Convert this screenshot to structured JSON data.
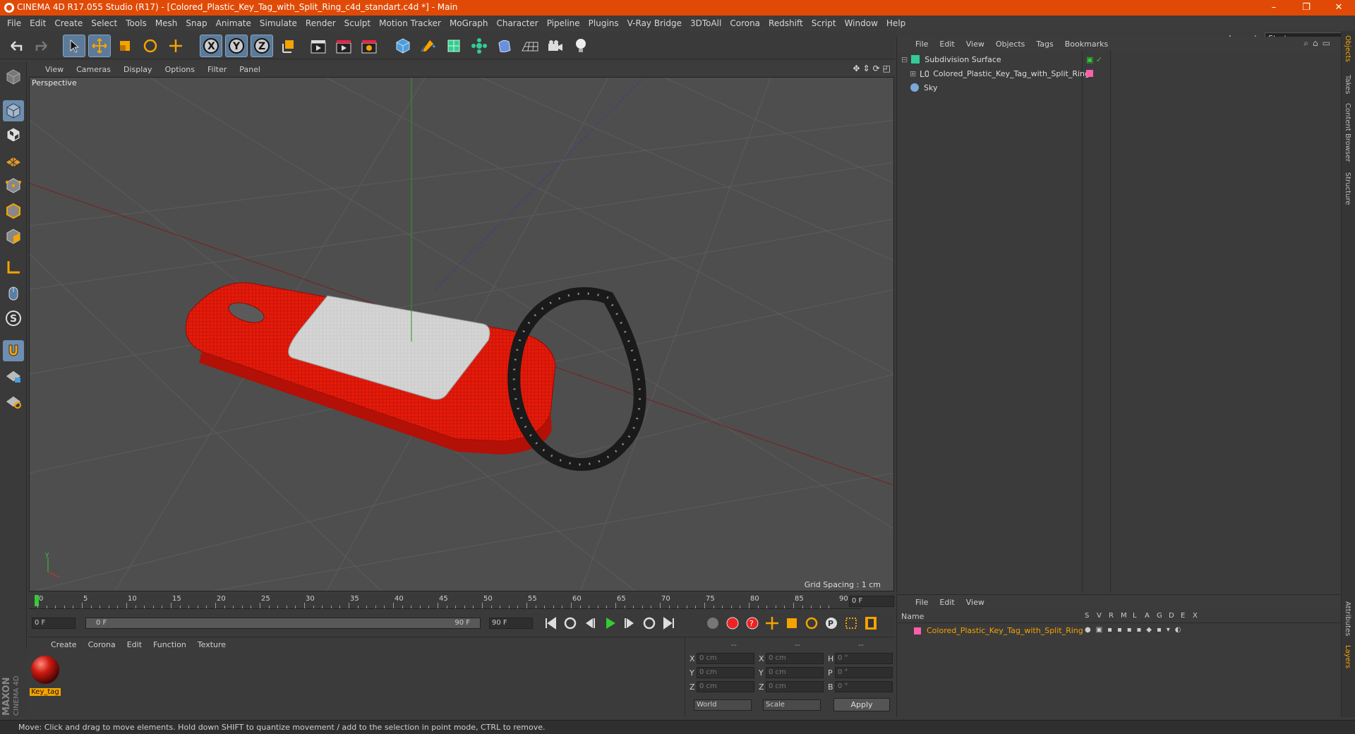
{
  "window": {
    "title": "CINEMA 4D R17.055 Studio (R17) - [Colored_Plastic_Key_Tag_with_Split_Ring_c4d_standart.c4d *] - Main",
    "minimize": "–",
    "maximize": "❐",
    "close": "✕"
  },
  "menu": [
    "File",
    "Edit",
    "Create",
    "Select",
    "Tools",
    "Mesh",
    "Snap",
    "Animate",
    "Simulate",
    "Render",
    "Sculpt",
    "Motion Tracker",
    "MoGraph",
    "Character",
    "Pipeline",
    "Plugins",
    "V-Ray Bridge",
    "3DToAll",
    "Corona",
    "Redshift",
    "Script",
    "Window",
    "Help"
  ],
  "layout": {
    "label": "Layout:",
    "value": "Startup"
  },
  "viewport": {
    "menu": [
      "View",
      "Cameras",
      "Display",
      "Options",
      "Filter",
      "Panel"
    ],
    "label": "Perspective",
    "grid_spacing": "Grid Spacing : 1 cm"
  },
  "timeline": {
    "ticks": [
      "0",
      "5",
      "10",
      "15",
      "20",
      "25",
      "30",
      "35",
      "40",
      "45",
      "50",
      "55",
      "60",
      "65",
      "70",
      "75",
      "80",
      "85",
      "90"
    ],
    "current_frame": "0 F",
    "start": "0 F",
    "range_start": "0 F",
    "range_end": "90 F",
    "end": "90 F"
  },
  "material_manager": {
    "menu": [
      "Create",
      "Corona",
      "Edit",
      "Function",
      "Texture"
    ],
    "materials": [
      {
        "name": "Key_tag",
        "color": "#cc1a10"
      }
    ]
  },
  "coordinates": {
    "headers": [
      "--",
      "--",
      "--"
    ],
    "rows": [
      {
        "a": "X",
        "av": "0 cm",
        "b": "X",
        "bv": "0 cm",
        "c": "H",
        "cv": "0 °"
      },
      {
        "a": "Y",
        "av": "0 cm",
        "b": "Y",
        "bv": "0 cm",
        "c": "P",
        "cv": "0 °"
      },
      {
        "a": "Z",
        "av": "0 cm",
        "b": "Z",
        "bv": "0 cm",
        "c": "B",
        "cv": "0 °"
      }
    ],
    "mode1": "World",
    "mode2": "Scale",
    "apply": "Apply"
  },
  "object_manager": {
    "menu": [
      "File",
      "Edit",
      "View",
      "Objects",
      "Tags",
      "Bookmarks"
    ],
    "objects": [
      {
        "name": "Subdivision Surface",
        "icon": "subdivision-icon"
      },
      {
        "name": "Colored_Plastic_Key_Tag_with_Split_Ring",
        "icon": "null-icon"
      },
      {
        "name": "Sky",
        "icon": "sky-icon"
      }
    ]
  },
  "layer_manager": {
    "menu": [
      "File",
      "Edit",
      "View"
    ],
    "header_name": "Name",
    "columns": [
      "S",
      "V",
      "R",
      "M",
      "L",
      "A",
      "G",
      "D",
      "E",
      "X"
    ],
    "layers": [
      {
        "name": "Colored_Plastic_Key_Tag_with_Split_Ring",
        "color": "#ff5fa8"
      }
    ]
  },
  "right_tabs": [
    "Objects",
    "Takes",
    "Content Browser",
    "Structure"
  ],
  "right_tabs_bottom": [
    "Attributes",
    "Layers"
  ],
  "brand": [
    "MAXON",
    "CINEMA 4D"
  ],
  "status": "Move: Click and drag to move elements. Hold down SHIFT to quantize movement / add to the selection in point mode, CTRL to remove.",
  "colors": {
    "title_bar": "#e04a06",
    "key_tag": "#dd1508",
    "ring": "#1a1a1a",
    "tag_label": "#cfcfcf",
    "highlight": "#f4a300"
  }
}
